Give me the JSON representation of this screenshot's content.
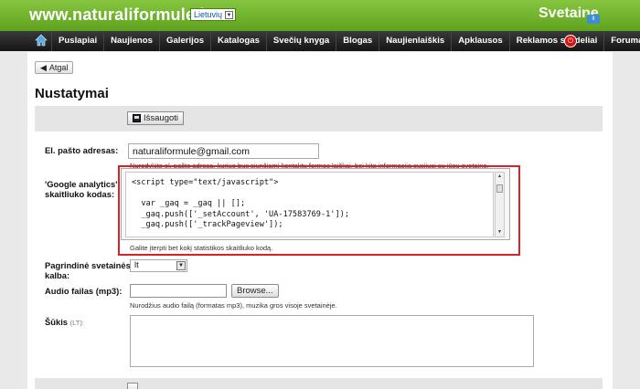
{
  "header": {
    "site_url": "www.naturaliformule.lt",
    "language": "Lietuvių",
    "logo_text": "Svetaine",
    "logo_badge": "lt"
  },
  "nav": {
    "items": [
      "Puslapiai",
      "Naujienos",
      "Galerijos",
      "Katalogas",
      "Svečių knyga",
      "Blogas",
      "Naujienlaiškis",
      "Apklausos",
      "Reklamos skydeliai",
      "Forumas"
    ]
  },
  "page": {
    "back_label": "Atgal",
    "title": "Nustatymai",
    "save_label": "Išsaugoti"
  },
  "form": {
    "email": {
      "label": "El. pašto adresas:",
      "value": "naturaliformule@gmail.com",
      "hint": "Nurodykite el. pašto adresą, kuriuo bus siunčiami kontaktų formos laiškai, bei kita informacija susijusi su jūsų svetaine."
    },
    "analytics": {
      "label_line1": "'Google analytics'",
      "label_line2": "skaitliuko kodas:",
      "code_lines": [
        "<script type=\"text/javascript\">",
        "",
        "  var _gaq = _gaq || [];",
        "  _gaq.push(['_setAccount', 'UA-17583769-1']);",
        "  _gaq.push(['_trackPageview']);"
      ],
      "hint": "Galite įterpti bet kokį statistikos skaitliuko kodą."
    },
    "language": {
      "label_line1": "Pagrindinė svetainės",
      "label_line2": "kalba:",
      "value": "lt"
    },
    "audio": {
      "label": "Audio failas (mp3):",
      "browse_label": "Browse...",
      "hint": "Nurodžius audio failą (formatas mp3), muzika gros visoje svetainėje."
    },
    "sukis": {
      "label": "Šūkis",
      "lang_tag": "(LT):"
    }
  },
  "colors": {
    "header_green": "#6cb12a",
    "nav_black": "#1f1f1f",
    "highlight_red": "#d6232a"
  }
}
